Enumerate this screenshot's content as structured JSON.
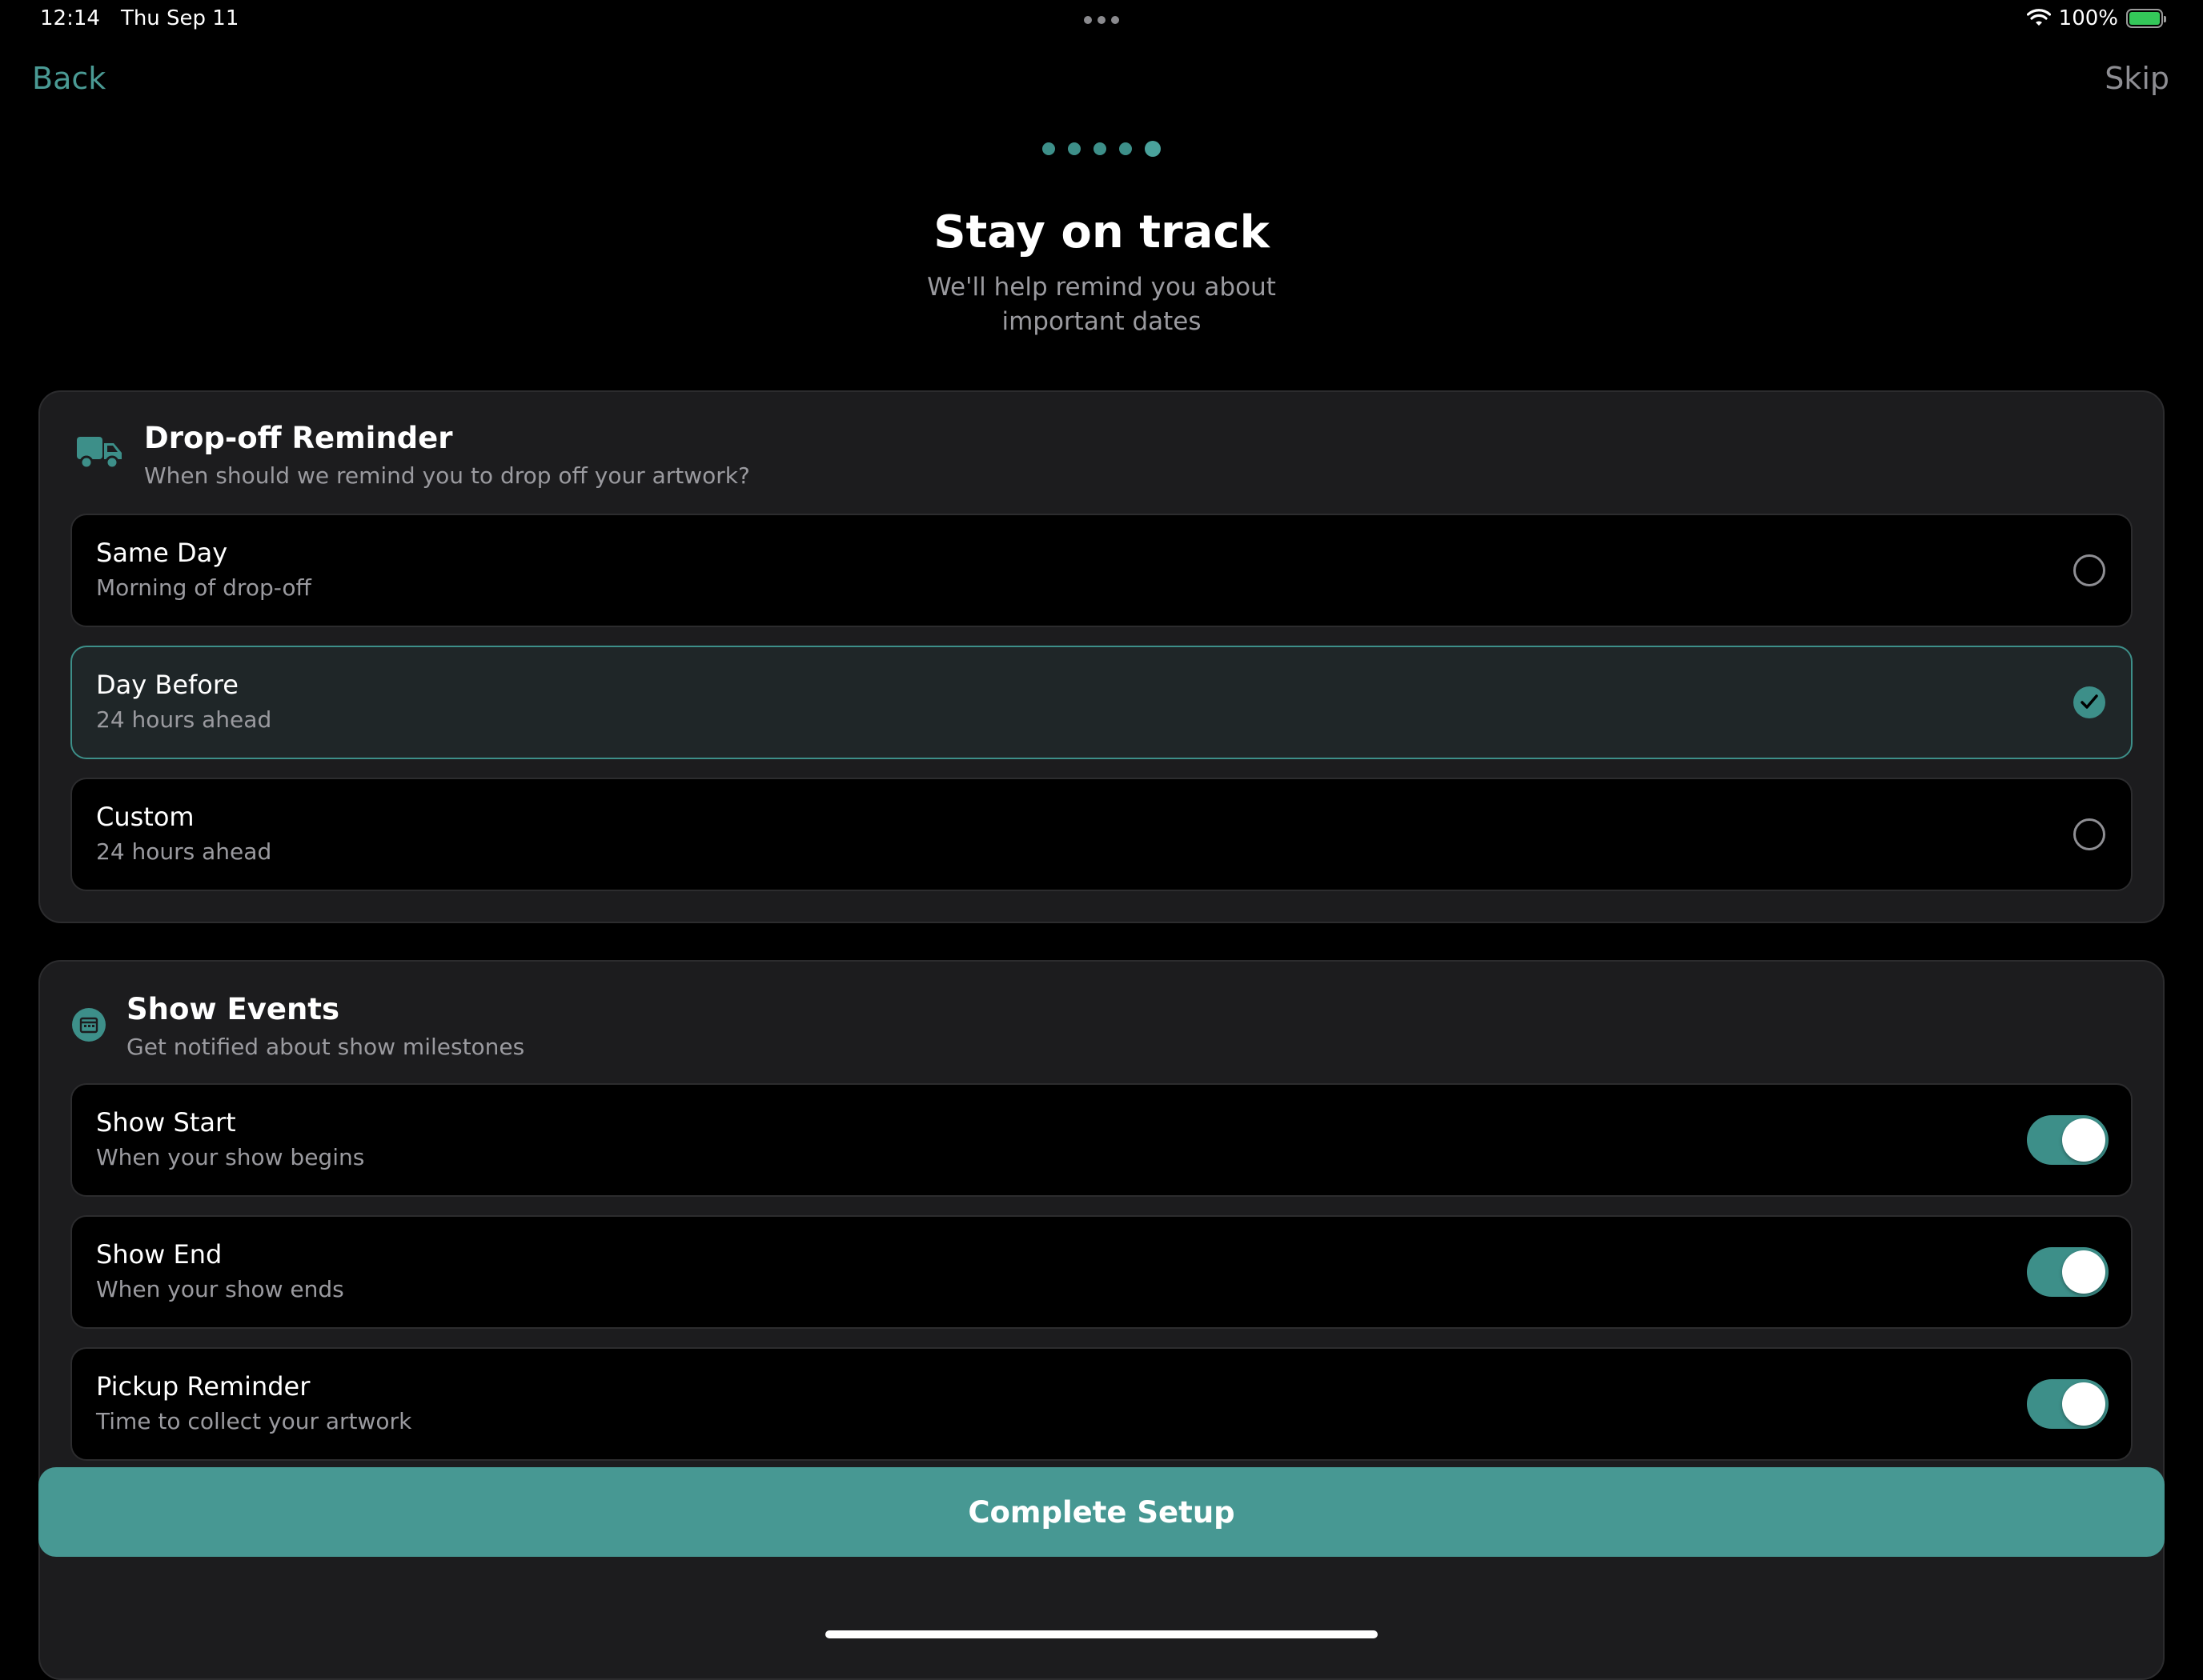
{
  "status_bar": {
    "time": "12:14",
    "date": "Thu Sep 11",
    "battery": "100%",
    "battery_level": 1.0
  },
  "nav": {
    "back_label": "Back",
    "skip_label": "Skip"
  },
  "progress": {
    "total_steps": 5,
    "current_step": 5
  },
  "header": {
    "title": "Stay on track",
    "subtitle": "We'll help remind you about important dates"
  },
  "dropoff": {
    "icon": "truck-icon",
    "title": "Drop-off Reminder",
    "subtitle": "When should we remind you to drop off your artwork?",
    "options": [
      {
        "title": "Same Day",
        "subtitle": "Morning of drop-off",
        "selected": false
      },
      {
        "title": "Day Before",
        "subtitle": "24 hours ahead",
        "selected": true
      },
      {
        "title": "Custom",
        "subtitle": "24 hours ahead",
        "selected": false
      }
    ]
  },
  "show_events": {
    "icon": "calendar-icon",
    "title": "Show Events",
    "subtitle": "Get notified about show milestones",
    "items": [
      {
        "title": "Show Start",
        "subtitle": "When your show begins",
        "enabled": true
      },
      {
        "title": "Show End",
        "subtitle": "When your show ends",
        "enabled": true
      },
      {
        "title": "Pickup Reminder",
        "subtitle": "Time to collect your artwork",
        "enabled": true
      }
    ]
  },
  "footer": {
    "complete_label": "Complete Setup"
  },
  "colors": {
    "accent": "#479893",
    "card_bg": "#1c1c1e",
    "selected_bg": "#1f2628",
    "battery_green": "#34c759"
  }
}
